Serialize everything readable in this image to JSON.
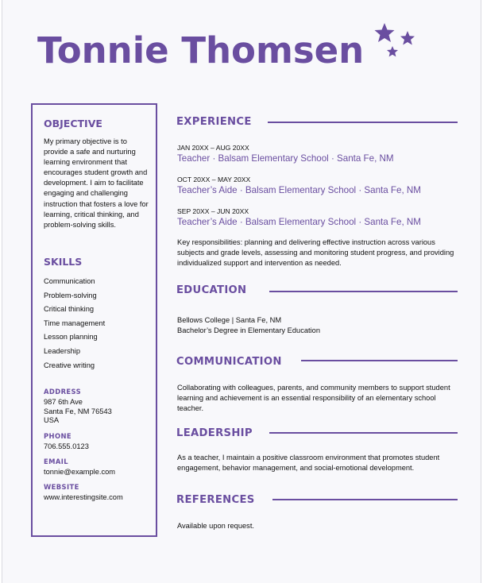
{
  "name": "Tonnie Thomsen",
  "accent_color": "#6a4ea0",
  "decor": "stars-icon",
  "sidebar": {
    "objective_heading": "OBJECTIVE",
    "objective_text": "My primary objective is to provide a safe and nurturing learning environment that encourages student growth and development. I aim to facilitate engaging and challenging instruction that fosters a love for learning, critical thinking, and problem-solving skills.",
    "skills_heading": "SKILLS",
    "skills": [
      "Communication",
      "Problem-solving",
      "Critical thinking",
      "Time management",
      "Lesson planning",
      "Leadership",
      "Creative writing"
    ],
    "address_label": "ADDRESS",
    "address": "987 6th Ave\nSanta Fe, NM 76543\nUSA",
    "phone_label": "PHONE",
    "phone": "706.555.0123",
    "email_label": "EMAIL",
    "email": "tonnie@example.com",
    "website_label": "WEBSITE",
    "website": "www.interestingsite.com"
  },
  "experience": {
    "heading": "EXPERIENCE",
    "jobs": [
      {
        "dates": "JAN 20XX – AUG 20XX",
        "role": "Teacher · Balsam Elementary School · Santa Fe, NM"
      },
      {
        "dates": "OCT 20XX – MAY 20XX",
        "role": "Teacher’s Aide · Balsam Elementary School · Santa Fe, NM"
      },
      {
        "dates": "SEP 20XX – JUN 20XX",
        "role": "Teacher’s Aide · Balsam Elementary School · Santa Fe, NM"
      }
    ],
    "responsibilities": "Key responsibilities: planning and delivering effective instruction across various subjects and grade levels, assessing and monitoring student progress, and providing individualized support and intervention as needed."
  },
  "education": {
    "heading": "EDUCATION",
    "school": "Bellows College | Santa Fe, NM",
    "degree": "Bachelor’s Degree in Elementary Education"
  },
  "communication": {
    "heading": "COMMUNICATION",
    "text": "Collaborating with colleagues, parents, and community members to support student learning and achievement is an essential responsibility of an elementary school teacher."
  },
  "leadership": {
    "heading": "LEADERSHIP",
    "text": "As a teacher, I maintain a positive classroom environment that promotes student engagement, behavior management, and social-emotional development."
  },
  "references": {
    "heading": "REFERENCES",
    "text": "Available upon request."
  }
}
